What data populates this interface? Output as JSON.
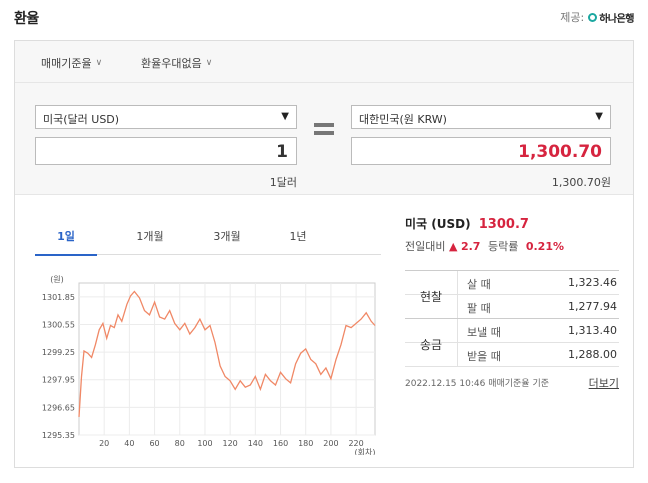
{
  "header": {
    "title": "환율",
    "provider_label": "제공:",
    "provider_name": "하나은행"
  },
  "filters": {
    "basis": "매매기준율",
    "preference": "환율우대없음"
  },
  "converter": {
    "from_currency": "미국(달러 USD)",
    "from_amount": "1",
    "from_caption": "1달러",
    "to_currency": "대한민국(원 KRW)",
    "to_amount": "1,300.70",
    "to_caption": "1,300.70원"
  },
  "tabs": [
    "1일",
    "1개월",
    "3개월",
    "1년"
  ],
  "summary": {
    "country": "미국 (USD)",
    "rate": "1300.7",
    "change_label": "전일대비",
    "change_icon": "triangle-up-icon",
    "change_value": "2.7",
    "change_rate_label": "등락률",
    "change_rate": "0.21%"
  },
  "rate_table": [
    {
      "group": "현찰",
      "rows": [
        {
          "label": "살 때",
          "value": "1,323.46"
        },
        {
          "label": "팔 때",
          "value": "1,277.94"
        }
      ]
    },
    {
      "group": "송금",
      "rows": [
        {
          "label": "보낼 때",
          "value": "1,313.40"
        },
        {
          "label": "받을 때",
          "value": "1,288.00"
        }
      ]
    }
  ],
  "footnote": {
    "timestamp": "2022.12.15 10:46 매매기준율 기준",
    "more": "더보기"
  },
  "colors": {
    "accent": "#2a64c8",
    "up": "#d6243f",
    "line": "#f08866"
  },
  "chart_data": {
    "type": "line",
    "ylabel": "(원)",
    "xlabel": "(회차)",
    "ylim": [
      1295.35,
      1302.5
    ],
    "xlim": [
      0,
      235
    ],
    "yticks": [
      1301.85,
      1300.55,
      1299.25,
      1297.95,
      1296.65,
      1295.35
    ],
    "xticks": [
      20,
      40,
      60,
      80,
      100,
      120,
      140,
      160,
      180,
      200,
      220
    ],
    "grid": true,
    "series": [
      {
        "x": [
          0,
          2,
          4,
          7,
          10,
          13,
          16,
          19,
          22,
          25,
          28,
          31,
          34,
          38,
          41,
          44,
          48,
          52,
          56,
          60,
          64,
          68,
          72,
          76,
          80,
          84,
          88,
          92,
          96,
          100,
          104,
          108,
          112,
          116,
          120,
          124,
          128,
          132,
          136,
          140,
          144,
          148,
          152,
          156,
          160,
          164,
          168,
          172,
          176,
          180,
          184,
          188,
          192,
          196,
          200,
          204,
          208,
          212,
          216,
          220,
          224,
          228,
          232,
          235
        ],
        "y": [
          1296.2,
          1298.1,
          1299.3,
          1299.2,
          1299.0,
          1299.6,
          1300.3,
          1300.6,
          1299.9,
          1300.5,
          1300.4,
          1301.0,
          1300.7,
          1301.5,
          1301.9,
          1302.1,
          1301.8,
          1301.2,
          1301.0,
          1301.6,
          1300.9,
          1300.8,
          1301.2,
          1300.6,
          1300.3,
          1300.6,
          1300.1,
          1300.4,
          1300.8,
          1300.3,
          1300.5,
          1299.7,
          1298.6,
          1298.1,
          1297.9,
          1297.5,
          1297.9,
          1297.6,
          1297.7,
          1298.1,
          1297.5,
          1298.2,
          1297.9,
          1297.7,
          1298.3,
          1298.0,
          1297.8,
          1298.7,
          1299.2,
          1299.4,
          1298.9,
          1298.7,
          1298.2,
          1298.5,
          1298.0,
          1298.9,
          1299.6,
          1300.5,
          1300.4,
          1300.6,
          1300.8,
          1301.1,
          1300.7,
          1300.5
        ]
      }
    ]
  }
}
